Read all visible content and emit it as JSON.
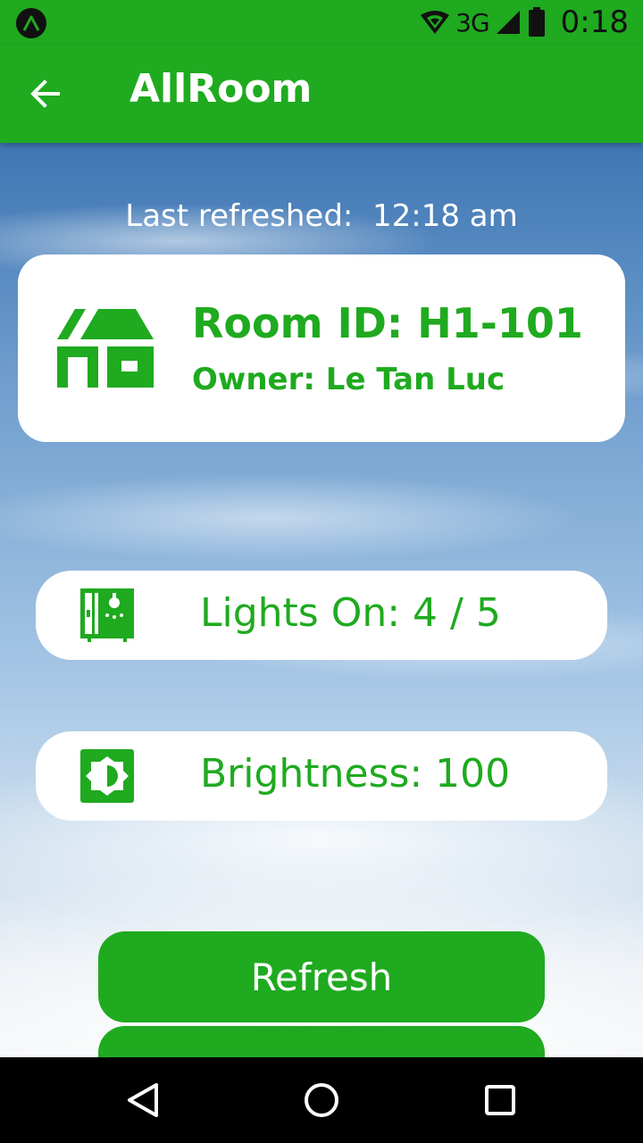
{
  "status_bar": {
    "network": "3G",
    "time": "0:18",
    "icons": [
      "app-notification-icon",
      "wifi-icon",
      "signal-icon",
      "battery-icon"
    ]
  },
  "app_bar": {
    "title": "AllRoom",
    "back_icon": "arrow-left-icon"
  },
  "main": {
    "last_refreshed": "Last refreshed:  12:18 am",
    "room": {
      "id_text": "Room ID: H1-101",
      "owner_text": "Owner: Le Tan Luc",
      "icon": "house-icon"
    },
    "lights": {
      "text": "Lights On: 4 / 5",
      "icon": "light-switch-icon"
    },
    "brightness": {
      "text": "Brightness: 100",
      "icon": "brightness-icon"
    },
    "buttons": {
      "refresh_label": "Refresh"
    }
  },
  "nav_bar": {
    "items": [
      "nav-back-icon",
      "nav-home-icon",
      "nav-recents-icon"
    ]
  },
  "colors": {
    "primary": "#1faa1f",
    "card": "#ffffff",
    "nav": "#000000"
  }
}
